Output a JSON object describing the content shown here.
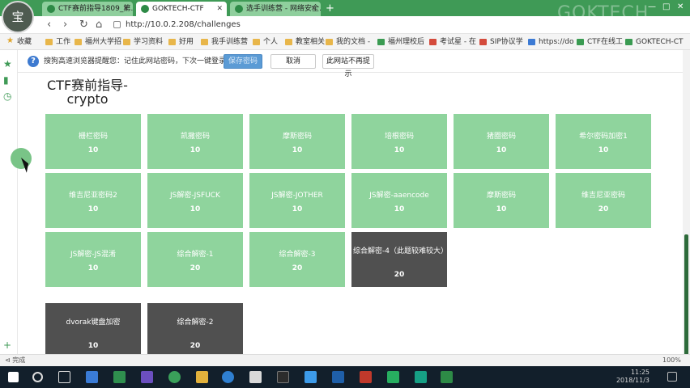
{
  "browser": {
    "avatar_glyph": "宝",
    "tabs": [
      {
        "label": "CTF赛前指导1809_第…",
        "state": "inactive"
      },
      {
        "label": "GOKTECH-CTF",
        "state": "active"
      },
      {
        "label": "选手训练营 - 网络安全…",
        "state": "inactive"
      }
    ],
    "new_tab_glyph": "+",
    "window_controls": [
      "—",
      "□",
      "✕"
    ],
    "watermark": "GOKTECH"
  },
  "address": {
    "url": "http://10.0.2.208/challenges",
    "nav": [
      "‹",
      "›",
      "↻",
      "⌂"
    ]
  },
  "bookmarks": [
    {
      "label": "收藏",
      "icon": "star-icon"
    },
    {
      "label": "工作",
      "icon": "folder-icon"
    },
    {
      "label": "福州大学招",
      "icon": "folder-icon"
    },
    {
      "label": "学习资料",
      "icon": "folder-icon"
    },
    {
      "label": "好用",
      "icon": "folder-icon"
    },
    {
      "label": "我手训练营",
      "icon": "folder-icon"
    },
    {
      "label": "个人",
      "icon": "folder-icon"
    },
    {
      "label": "教室相关",
      "icon": "folder-icon"
    },
    {
      "label": "我的文档 -",
      "icon": "folder-icon"
    },
    {
      "label": "福州理校后",
      "icon": "site-icon"
    },
    {
      "label": "考试星 - 在",
      "icon": "site-icon"
    },
    {
      "label": "SIP协议学",
      "icon": "site-icon"
    },
    {
      "label": "https://do",
      "icon": "site-icon"
    },
    {
      "label": "CTF在线工",
      "icon": "site-icon"
    },
    {
      "label": "GOKTECH-CT",
      "icon": "site-icon"
    }
  ],
  "password_bar": {
    "message": "搜狗高速浏览器提醒您：记住此网站密码，下次一键登录！",
    "save_label": "保存密码",
    "cancel_label": "取消",
    "never_label": "此网站不再提示"
  },
  "page": {
    "title_line1": "CTF赛前指导-",
    "title_line2": "crypto"
  },
  "challenges": [
    {
      "name": "栅栏密码",
      "points": "10",
      "solved": false
    },
    {
      "name": "凯撒密码",
      "points": "10",
      "solved": false
    },
    {
      "name": "摩斯密码",
      "points": "10",
      "solved": false
    },
    {
      "name": "培根密码",
      "points": "10",
      "solved": false
    },
    {
      "name": "猪圈密码",
      "points": "10",
      "solved": false
    },
    {
      "name": "希尔密码加密1",
      "points": "10",
      "solved": false
    },
    {
      "name": "维吉尼亚密码2",
      "points": "10",
      "solved": false
    },
    {
      "name": "JS解密-JSFUCK",
      "points": "10",
      "solved": false
    },
    {
      "name": "JS解密-JOTHER",
      "points": "10",
      "solved": false
    },
    {
      "name": "JS解密-aaencode",
      "points": "10",
      "solved": false
    },
    {
      "name": "摩斯密码",
      "points": "10",
      "solved": false
    },
    {
      "name": "维吉尼亚密码",
      "points": "20",
      "solved": false
    },
    {
      "name": "JS解密-JS混淆",
      "points": "10",
      "solved": false
    },
    {
      "name": "综合解密-1",
      "points": "20",
      "solved": false
    },
    {
      "name": "综合解密-3",
      "points": "20",
      "solved": false
    },
    {
      "name": "综合解密-4（此题较难较大）",
      "points": "20",
      "solved": true
    },
    {
      "name": "dvorak键盘加密",
      "points": "10",
      "solved": true
    },
    {
      "name": "综合解密-2",
      "points": "20",
      "solved": true
    }
  ],
  "status": {
    "left": "完成",
    "zoom": "100%"
  },
  "taskbar": {
    "time": "11:25",
    "date": "2018/11/3"
  }
}
